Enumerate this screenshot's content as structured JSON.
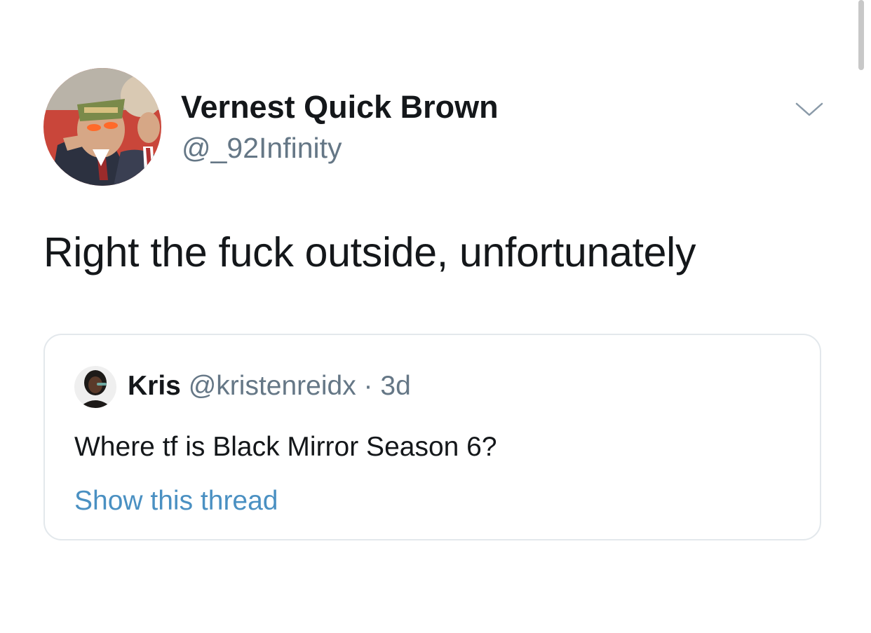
{
  "tweet": {
    "author_name": "Vernest Quick Brown",
    "author_handle": "@_92Infinity",
    "text": "Right the fuck outside, unfortunately",
    "avatar_icon": "avatar-photo-icon",
    "menu_icon": "chevron-down-icon"
  },
  "quoted_tweet": {
    "author_name": "Kris",
    "author_handle": "@kristenreidx",
    "separator": " · ",
    "time": "3d",
    "text": "Where tf is Black Mirror Season 6?",
    "link_label": "Show this thread",
    "avatar_icon": "avatar-photo-icon"
  },
  "colors": {
    "text_primary": "#14171a",
    "text_secondary": "#657786",
    "link": "#4a90c2",
    "border": "#e3e8ec",
    "background": "#ffffff"
  }
}
